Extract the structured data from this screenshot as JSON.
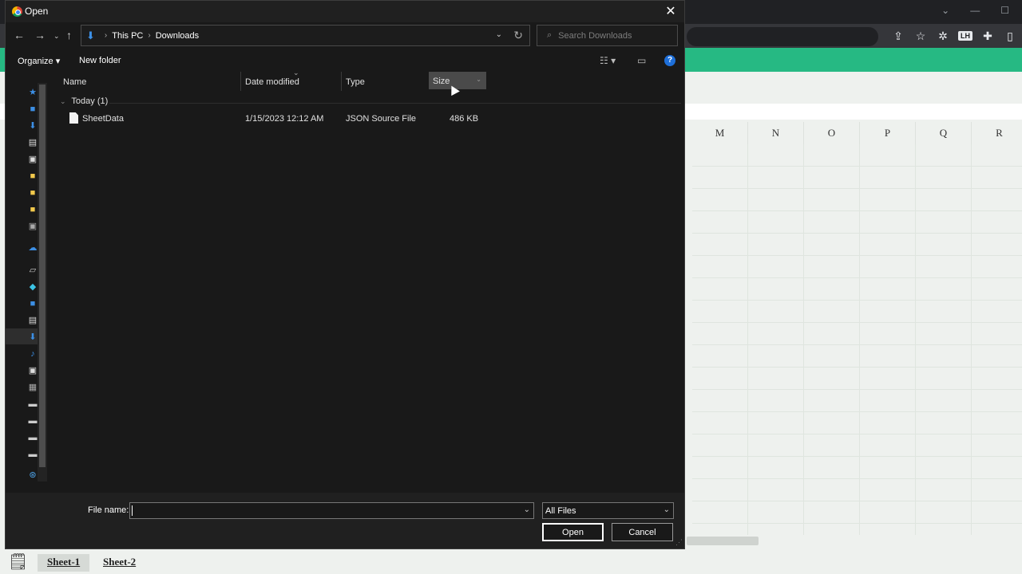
{
  "background_sheet": {
    "column_headers": [
      "M",
      "N",
      "O",
      "P",
      "Q",
      "R"
    ],
    "tabs": [
      {
        "label": "Sheet-1"
      },
      {
        "label": "Sheet-2"
      }
    ],
    "accent_color": "#26b983"
  },
  "dialog": {
    "title": "Open",
    "breadcrumb": [
      "This PC",
      "Downloads"
    ],
    "search_placeholder": "Search Downloads",
    "commands": {
      "organize": "Organize",
      "new_folder": "New folder"
    },
    "columns": {
      "name": "Name",
      "date_modified": "Date modified",
      "type": "Type",
      "size": "Size"
    },
    "group": {
      "label": "Today (1)"
    },
    "files": [
      {
        "name": "SheetData",
        "date_modified": "1/15/2023 12:12 AM",
        "type": "JSON Source File",
        "size": "486 KB"
      }
    ],
    "footer": {
      "file_name_label": "File name:",
      "file_name_value": "",
      "filter": "All Files",
      "open_label": "Open",
      "cancel_label": "Cancel"
    }
  }
}
